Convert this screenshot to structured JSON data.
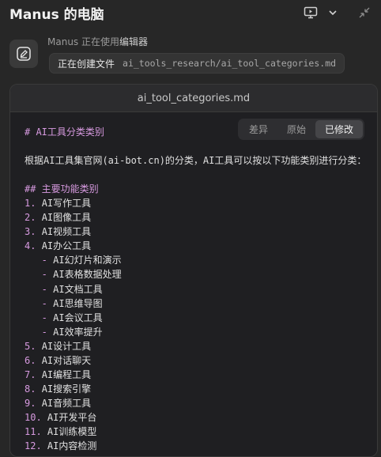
{
  "header": {
    "title": "Manus 的电脑",
    "icons": [
      "monitor-play-icon",
      "chevron-down-icon",
      "collapse-icon"
    ]
  },
  "status": {
    "tool_icon": "edit-icon",
    "agent": "Manus",
    "using_text": "正在使用",
    "tool_name": "编辑器",
    "action_verb": "正在创建文件",
    "action_path": "ai_tools_research/ai_tool_categories.md"
  },
  "editor": {
    "filename": "ai_tool_categories.md",
    "tabs": [
      {
        "label": "差异",
        "active": false
      },
      {
        "label": "原始",
        "active": false
      },
      {
        "label": "已修改",
        "active": true
      }
    ],
    "heading1": "# AI工具分类类别",
    "intro": "根据AI工具集官网(ai-bot.cn)的分类，AI工具可以按以下功能类别进行分类：",
    "heading2": "## 主要功能类别",
    "items": [
      {
        "marker": "1.",
        "text": "AI写作工具"
      },
      {
        "marker": "2.",
        "text": "AI图像工具"
      },
      {
        "marker": "3.",
        "text": "AI视频工具"
      },
      {
        "marker": "4.",
        "text": "AI办公工具"
      },
      {
        "marker": "   -",
        "text": "AI幻灯片和演示"
      },
      {
        "marker": "   -",
        "text": "AI表格数据处理"
      },
      {
        "marker": "   -",
        "text": "AI文档工具"
      },
      {
        "marker": "   -",
        "text": "AI思维导图"
      },
      {
        "marker": "   -",
        "text": "AI会议工具"
      },
      {
        "marker": "   -",
        "text": "AI效率提升"
      },
      {
        "marker": "5.",
        "text": "AI设计工具"
      },
      {
        "marker": "6.",
        "text": "AI对话聊天"
      },
      {
        "marker": "7.",
        "text": "AI编程工具"
      },
      {
        "marker": "8.",
        "text": "AI搜索引擎"
      },
      {
        "marker": "9.",
        "text": "AI音频工具"
      },
      {
        "marker": "10.",
        "text": "AI开发平台"
      },
      {
        "marker": "11.",
        "text": "AI训练模型"
      },
      {
        "marker": "12.",
        "text": "AI内容检测"
      }
    ]
  }
}
